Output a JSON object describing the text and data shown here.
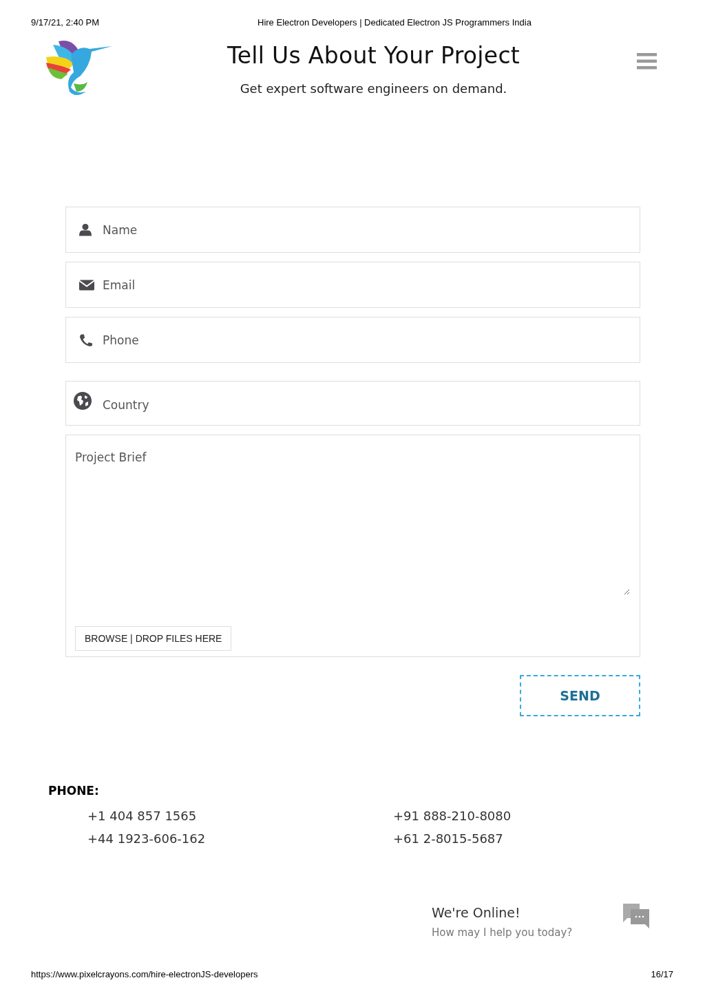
{
  "print_header": {
    "date": "9/17/21, 2:40 PM",
    "title": "Hire Electron Developers | Dedicated Electron JS Programmers India"
  },
  "hero": {
    "title": "Tell Us About Your Project",
    "subtitle": "Get expert software engineers on demand."
  },
  "form": {
    "fields": [
      {
        "placeholder": "Name"
      },
      {
        "placeholder": "Email"
      },
      {
        "placeholder": "Phone"
      },
      {
        "placeholder": "Country"
      }
    ],
    "brief": {
      "placeholder": "Project Brief"
    },
    "upload_button": "BROWSE | DROP FILES HERE",
    "submit_button": "SEND"
  },
  "contact": {
    "heading": "PHONE:",
    "numbers": [
      "+1 404 857 1565",
      "+91 888-210-8080",
      "+44 1923-606-162",
      "+61 2-8015-5687"
    ]
  },
  "chat": {
    "title": "We're Online!",
    "subtitle": "How may I help you today?"
  },
  "print_footer": {
    "url": "https://www.pixelcrayons.com/hire-electronJS-developers",
    "page": "16/17"
  }
}
